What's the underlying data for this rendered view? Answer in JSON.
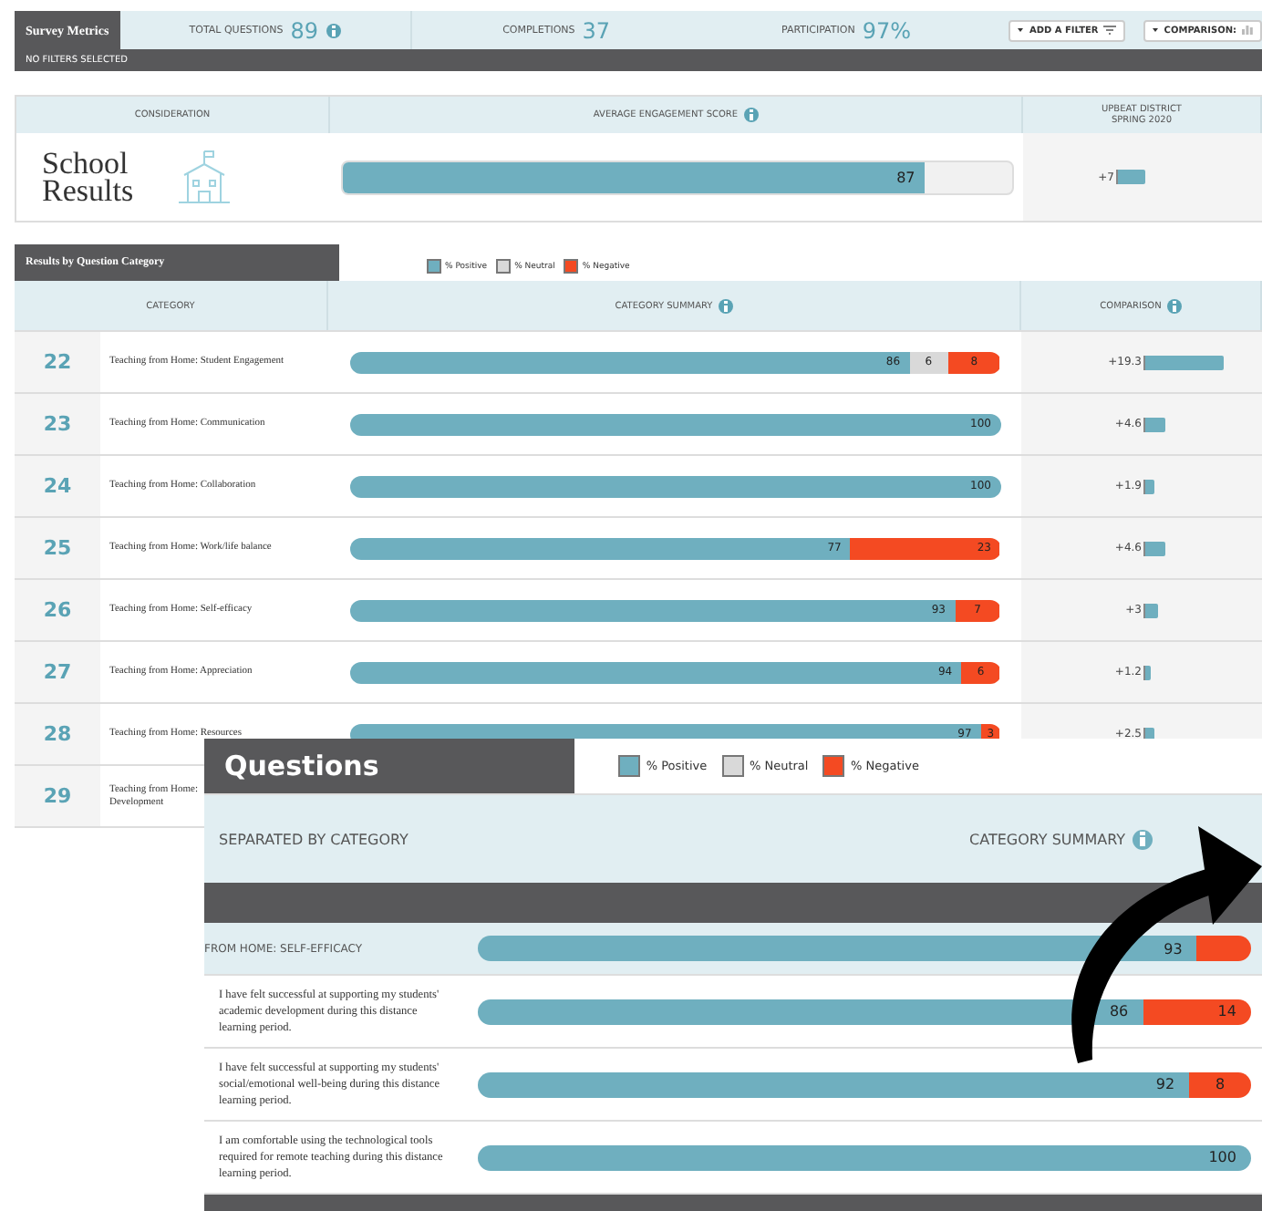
{
  "metrics_bar": {
    "title": "Survey Metrics",
    "stats": [
      {
        "label": "TOTAL QUESTIONS",
        "value": "89",
        "info": true
      },
      {
        "label": "COMPLETIONS",
        "value": "37",
        "info": false
      },
      {
        "label": "PARTICIPATION",
        "value": "97%",
        "info": false
      }
    ],
    "buttons": [
      {
        "label": "ADD A FILTER",
        "kind": "filter"
      },
      {
        "label": "COMPARISON:",
        "kind": "comparison"
      }
    ]
  },
  "filter_status": "NO FILTERS SELECTED",
  "summary_card": {
    "columns": [
      "CONSIDERATION",
      "AVERAGE ENGAGEMENT SCORE",
      "UPBEAT DISTRICT SPRING 2020"
    ],
    "title": "School Results",
    "score": {
      "reading": "87",
      "level": 0.87
    },
    "comparison": {
      "reading": "+7",
      "level": 0.17
    }
  },
  "category_section": {
    "title": "Results by Question Category",
    "legend": [
      {
        "label": "% Positive",
        "color": "#6fafbf"
      },
      {
        "label": "% Neutral",
        "color": "#d9d9d9"
      },
      {
        "label": "% Negative",
        "color": "#f44a22"
      }
    ],
    "columns": [
      "CATEGORY",
      "CATEGORY SUMMARY",
      "COMPARISON"
    ],
    "rows": [
      {
        "number": "22",
        "label": "Teaching from Home: Student Engagement",
        "positive": "86",
        "neutral": "6",
        "negative": "8",
        "comparison": {
          "reading": "+19.3",
          "level": 0.48
        }
      },
      {
        "number": "23",
        "label": "Teaching from Home: Communication",
        "positive": "100",
        "comparison": {
          "reading": "+4.6",
          "level": 0.12
        }
      },
      {
        "number": "24",
        "label": "Teaching from Home: Collaboration",
        "positive": "100",
        "comparison": {
          "reading": "+1.9",
          "level": 0.05
        }
      },
      {
        "number": "25",
        "label": "Teaching from Home: Work/life balance",
        "positive": "77",
        "negative": "23",
        "comparison": {
          "reading": "+4.6",
          "level": 0.12
        }
      },
      {
        "number": "26",
        "label": "Teaching from Home: Self-efficacy",
        "positive": "93",
        "negative": "7",
        "comparison": {
          "reading": "+3",
          "level": 0.08
        }
      },
      {
        "number": "27",
        "label": "Teaching from Home: Appreciation",
        "positive": "94",
        "negative": "6",
        "comparison": {
          "reading": "+1.2",
          "level": 0.03
        }
      },
      {
        "number": "28",
        "label": "Teaching from Home: Resources",
        "positive": "97",
        "negative": "3",
        "comparison": {
          "reading": "+2.5",
          "level": 0.06
        }
      },
      {
        "number": "29",
        "label": "Teaching from Home:\nDevelopment"
      }
    ]
  },
  "questions_panel": {
    "title": "Questions",
    "legend": [
      {
        "label": "% Positive",
        "color": "#6fafbf"
      },
      {
        "label": "% Neutral",
        "color": "#d9d9d9"
      },
      {
        "label": "% Negative",
        "color": "#f44a22"
      }
    ],
    "columns": [
      "SEPARATED BY CATEGORY",
      "CATEGORY SUMMARY"
    ],
    "category": {
      "label": "FROM HOME: SELF-EFFICACY",
      "positive": "93"
    },
    "questions": [
      {
        "text": "I have felt successful at supporting my students' academic development during this distance learning period.",
        "positive": "86",
        "negative": "14"
      },
      {
        "text": "I have felt successful at supporting my students' social/emotional well-being during this distance learning period.",
        "positive": "92",
        "negative": "8"
      },
      {
        "text": "I am comfortable using the technological tools required for remote teaching during this distance learning period.",
        "positive": "100"
      }
    ]
  }
}
